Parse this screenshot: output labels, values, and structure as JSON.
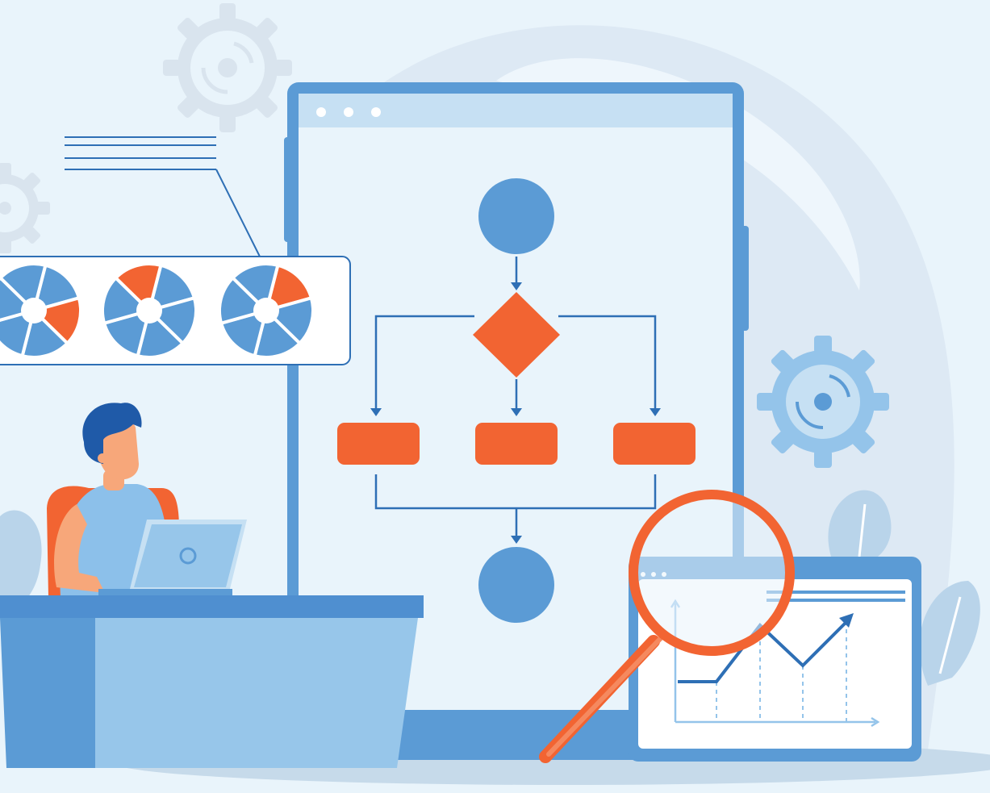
{
  "scene": {
    "description_free": true,
    "colors": {
      "background": "#e9f4fb",
      "backdrop_shape": "#dde9f4",
      "window_frame": "#5b9bd5",
      "window_screen": "#e9f4fb",
      "window_titlebar": "#c6e0f3",
      "flow_node": "#5b9bd5",
      "flow_accent": "#f26432",
      "flow_line": "#2e6fb5",
      "gear_light": "#d9e4ee",
      "gear_blue": "#94c4ea",
      "desk_top": "#4f8fd0",
      "desk_front": "#97c6ea",
      "chart_panel": "#ffffff",
      "magnifier_ring": "#f26432",
      "floor_shadow": "#c6daea",
      "hair": "#1f5aa8",
      "skin": "#f7a77a",
      "shirt": "#8cc0ea",
      "chair": "#f26432"
    },
    "icons": [
      "gear-icon",
      "gear-icon",
      "gear-icon",
      "pie-chart-icon",
      "pie-chart-icon",
      "pie-chart-icon",
      "magnifier-icon",
      "laptop-icon",
      "line-chart-icon",
      "flowchart-icon",
      "leaf-icon"
    ]
  }
}
